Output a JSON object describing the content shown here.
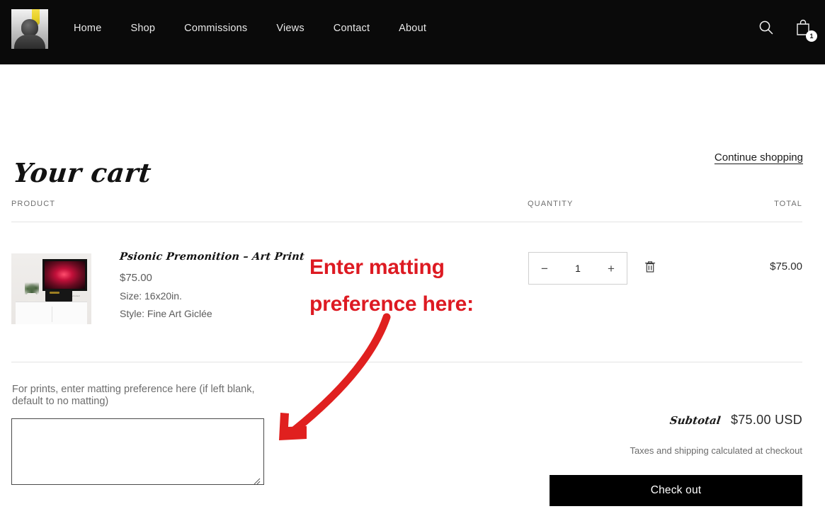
{
  "header": {
    "logo_alt": "artist-portrait-logo",
    "nav": [
      {
        "label": "Home"
      },
      {
        "label": "Shop"
      },
      {
        "label": "Commissions"
      },
      {
        "label": "Views"
      },
      {
        "label": "Contact"
      },
      {
        "label": "About"
      }
    ],
    "search_icon": "search-icon",
    "cart_icon": "shopping-bag-icon",
    "cart_count": "1"
  },
  "cart": {
    "title": "Your cart",
    "continue_shopping": "Continue shopping",
    "columns": {
      "product": "PRODUCT",
      "quantity": "QUANTITY",
      "total": "TOTAL"
    },
    "item": {
      "image_alt": "framed-art-print-on-wall-mockup",
      "name": "Psionic Premonition – Art Print",
      "price": "$75.00",
      "size": "Size: 16x20in.",
      "style": "Style: Fine Art Giclée",
      "qty_decrease": "−",
      "qty_value": "1",
      "qty_increase": "+",
      "remove_icon": "trash-icon",
      "line_total": "$75.00"
    },
    "note": {
      "label": "For prints, enter matting preference here (if left blank, default to no matting)",
      "value": "",
      "placeholder": ""
    },
    "summary": {
      "subtotal_label": "Subtotal",
      "subtotal_value": "$75.00 USD",
      "tax_note": "Taxes and shipping calculated at checkout",
      "checkout_label": "Check out"
    }
  },
  "annotation": {
    "text_line1": "Enter matting",
    "text_line2": "preference here:",
    "color": "#DD1A22",
    "arrow": "curved-arrow-pointing-down-left"
  },
  "colors": {
    "header_bg": "#0a0a0a",
    "page_bg": "#ffffff",
    "accent_red": "#DD1A22",
    "checkout_bg": "#000000",
    "rule": "#e4e4e4",
    "muted_text": "#6d6d6d"
  }
}
